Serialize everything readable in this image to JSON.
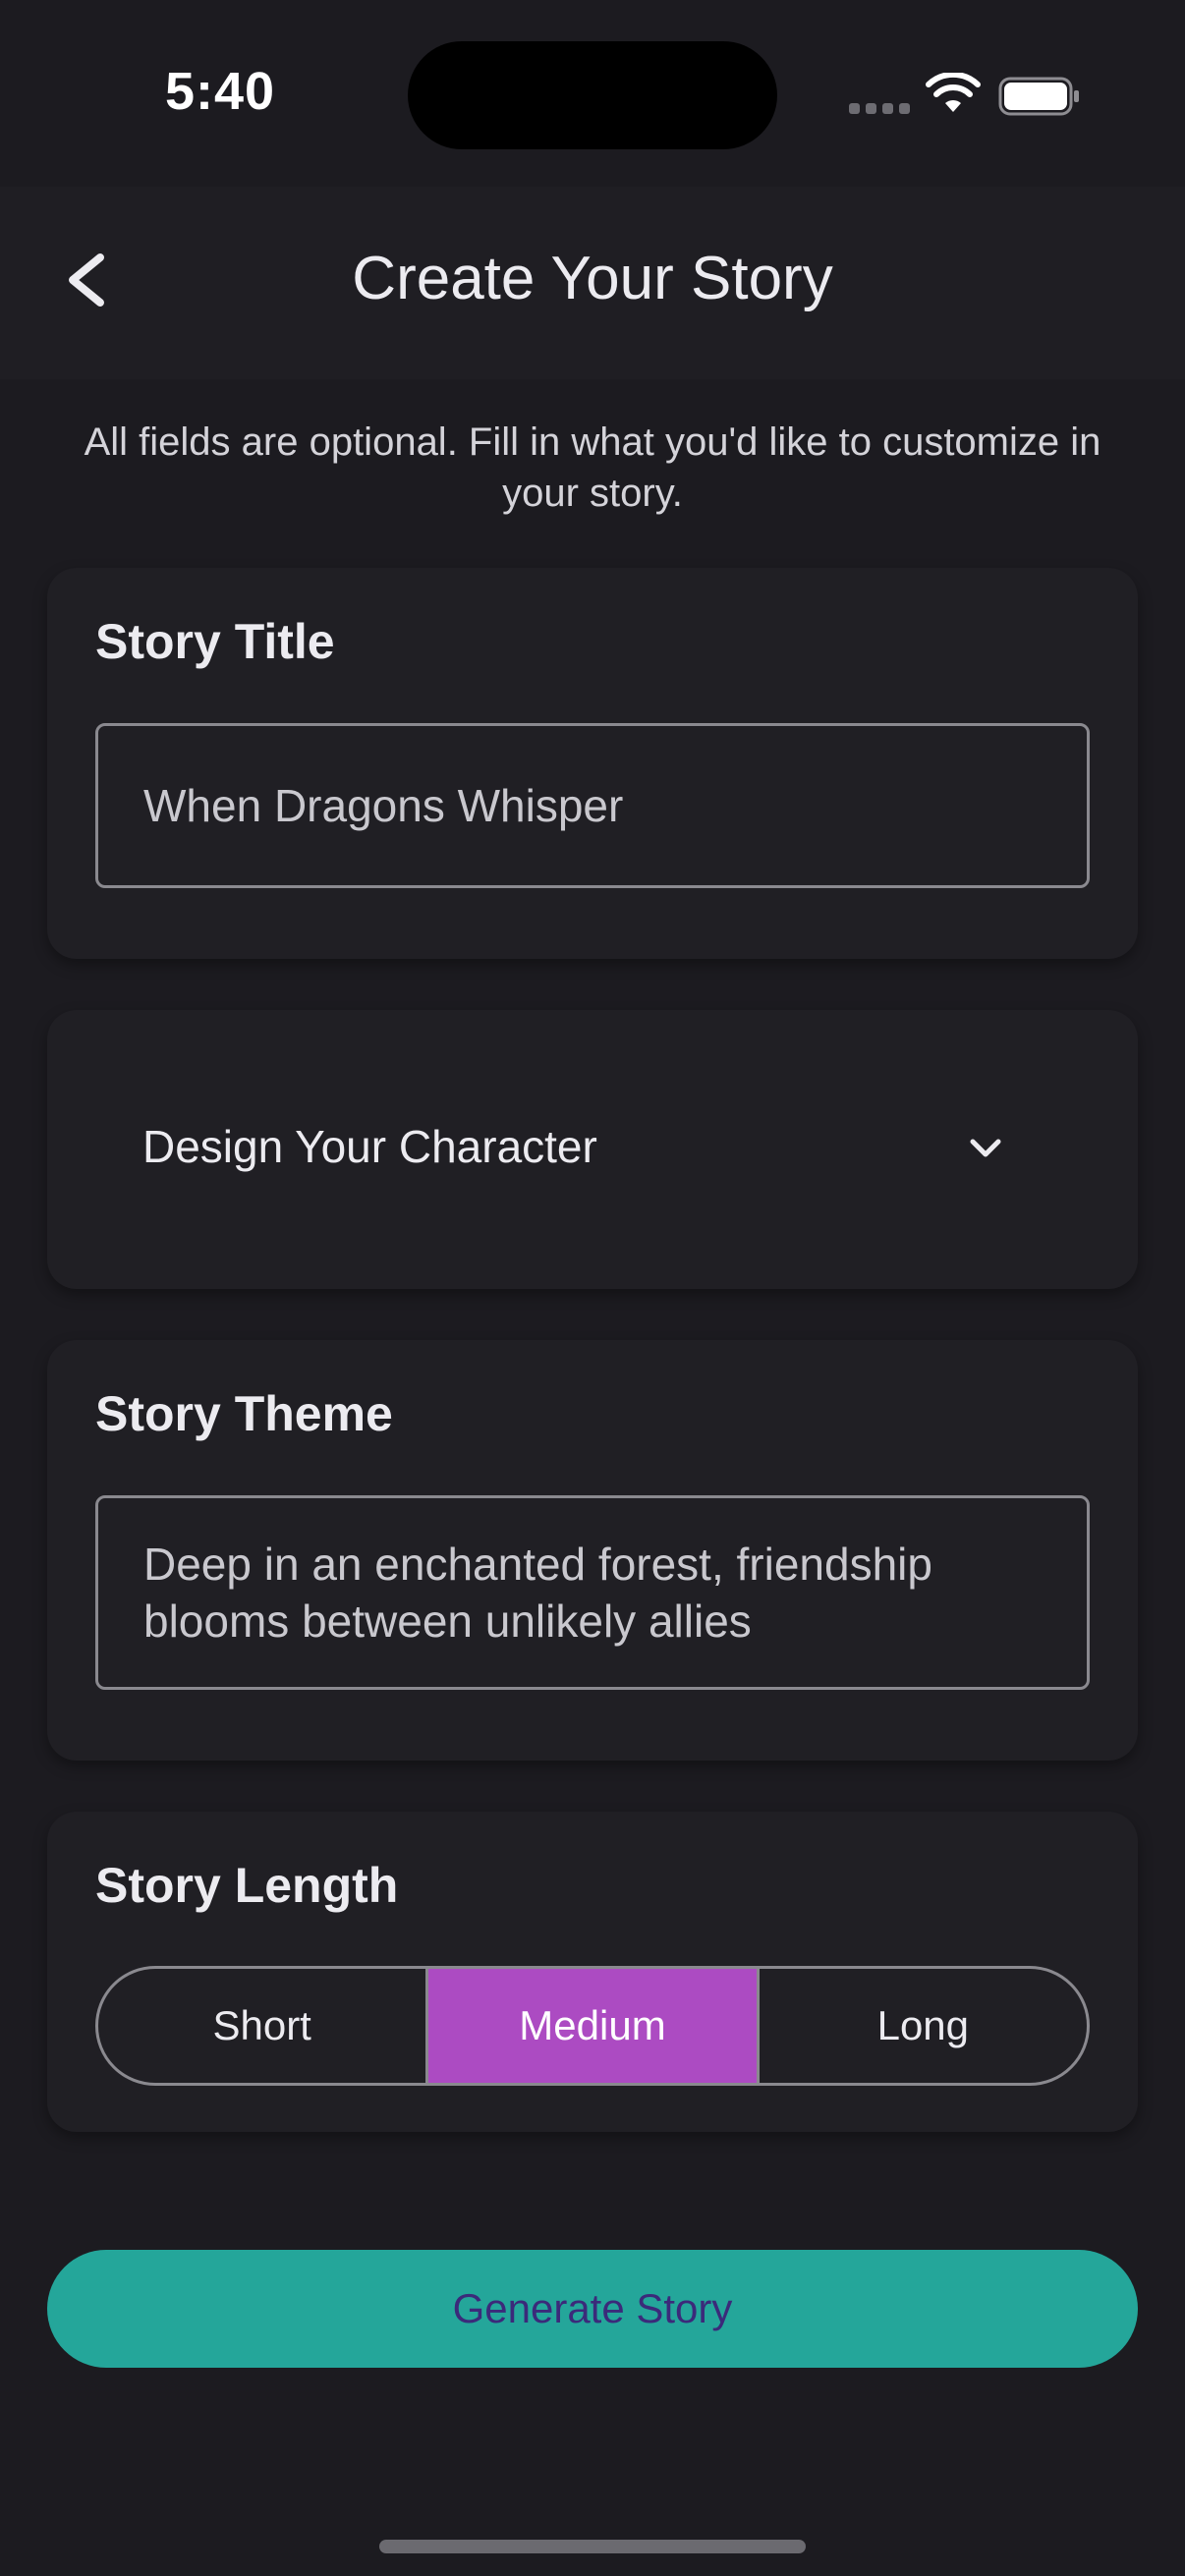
{
  "status_bar": {
    "time": "5:40",
    "icons": [
      "signal-icon",
      "wifi-icon",
      "battery-icon"
    ]
  },
  "header": {
    "title": "Create Your Story",
    "back_icon": "chevron-left-icon"
  },
  "subtitle": "All fields are optional. Fill in what you'd like to customize in your story.",
  "story_title": {
    "heading": "Story Title",
    "value": "When Dragons Whisper"
  },
  "character": {
    "label": "Design Your Character",
    "icon": "chevron-down-icon"
  },
  "story_theme": {
    "heading": "Story Theme",
    "value": "Deep in an enchanted forest, friendship blooms between unlikely allies"
  },
  "story_length": {
    "heading": "Story Length",
    "options": [
      "Short",
      "Medium",
      "Long"
    ],
    "selected": "Medium"
  },
  "generate_button": {
    "label": "Generate Story"
  },
  "colors": {
    "background": "#1c1b20",
    "card": "#201f24",
    "accent_selected": "#ac4bc2",
    "primary_button": "#24a69a",
    "primary_button_text": "#3b2a7a"
  }
}
